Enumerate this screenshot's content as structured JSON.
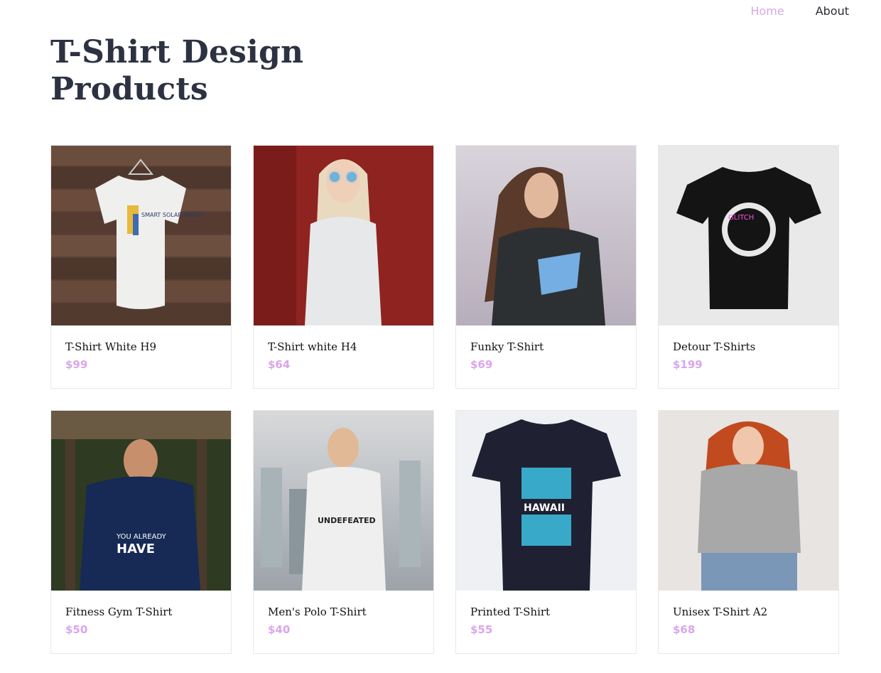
{
  "nav": {
    "items": [
      {
        "label": "Home",
        "active": true
      },
      {
        "label": "About",
        "active": false
      }
    ]
  },
  "page": {
    "title": "T-Shirt Design Products"
  },
  "colors": {
    "accent": "#d9a6ea",
    "title": "#2c3241"
  },
  "products": [
    {
      "name": "T-Shirt White H9",
      "price": "$99",
      "image": "white-tshirt-on-hanger"
    },
    {
      "name": "T-Shirt white H4",
      "price": "$64",
      "image": "woman-in-white-tshirt"
    },
    {
      "name": "Funky T-Shirt",
      "price": "$69",
      "image": "woman-in-dark-tshirt"
    },
    {
      "name": "Detour T-Shirts",
      "price": "$199",
      "image": "black-glitch-tshirt"
    },
    {
      "name": "Fitness Gym T-Shirt",
      "price": "$50",
      "image": "man-in-navy-gym-tshirt"
    },
    {
      "name": "Men's Polo T-Shirt",
      "price": "$40",
      "image": "man-in-white-undefeated-tshirt"
    },
    {
      "name": "Printed T-Shirt",
      "price": "$55",
      "image": "navy-hawaii-tshirt"
    },
    {
      "name": "Unisex T-Shirt A2",
      "price": "$68",
      "image": "woman-in-grey-tshirt"
    }
  ],
  "print_text": {
    "p0": "SMART SOLAR DIRECT",
    "p3": "GLITCH",
    "p4_a": "YOU ALREADY",
    "p4_b": "HAVE",
    "p5": "UNDEFEATED",
    "p6": "HAWAII"
  }
}
